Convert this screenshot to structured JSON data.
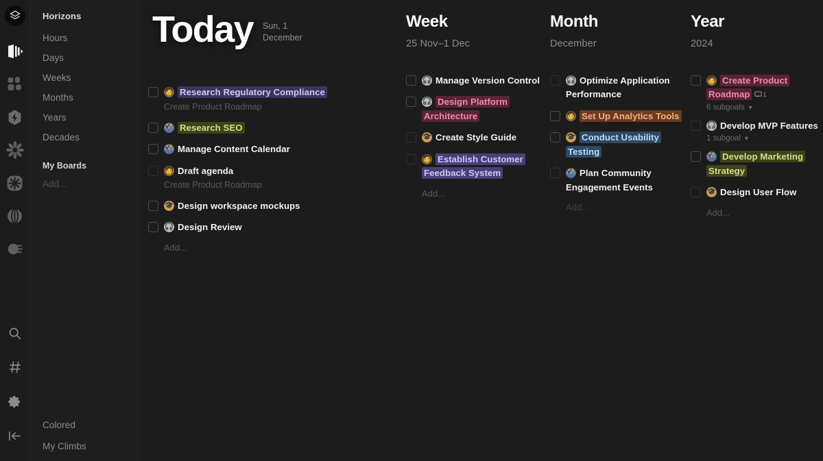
{
  "rail": {
    "icons": [
      {
        "name": "layers-logo-icon",
        "label": "Layers"
      },
      {
        "name": "book-open-icon",
        "label": "Journal"
      },
      {
        "name": "petals-grid-icon",
        "label": "Boards"
      },
      {
        "name": "hexagon-bolt-icon",
        "label": "Energy"
      },
      {
        "name": "flower-burst-icon",
        "label": "Flower"
      },
      {
        "name": "star-square-icon",
        "label": "Star"
      },
      {
        "name": "globe-lines-icon",
        "label": "Globe"
      },
      {
        "name": "comet-icon",
        "label": "Comet"
      }
    ],
    "bottom_icons": [
      {
        "name": "search-icon",
        "label": "Search"
      },
      {
        "name": "hash-icon",
        "label": "Tags"
      },
      {
        "name": "gear-icon",
        "label": "Settings"
      },
      {
        "name": "collapse-sidebar-icon",
        "label": "Collapse"
      }
    ]
  },
  "sidebar": {
    "heading": "Horizons",
    "items": [
      {
        "label": "Hours"
      },
      {
        "label": "Days"
      },
      {
        "label": "Weeks"
      },
      {
        "label": "Months"
      },
      {
        "label": "Years"
      },
      {
        "label": "Decades"
      }
    ],
    "boards_heading": "My Boards",
    "boards_add": "Add...",
    "footer": [
      {
        "label": "Colored"
      },
      {
        "label": "My Climbs"
      }
    ]
  },
  "columns": {
    "today": {
      "title": "Today",
      "subtitle": "Sun, 1 December",
      "add_label": "Add...",
      "add_dim": false,
      "tasks": [
        {
          "title": "Research Regulatory Compliance",
          "sub": "Create Product Roadmap",
          "avatar": "person-avatar",
          "avatar_color": "#8a6a4e",
          "highlight_bg": "#3a3560",
          "highlight_fg": "#cfc9ee",
          "checkbox_dim": false
        },
        {
          "title": "Research SEO",
          "sub": "",
          "avatar": "people-avatar",
          "avatar_color": "#5a6fa8",
          "highlight_bg": "#3f4318",
          "highlight_fg": "#d4dd8e",
          "checkbox_dim": false
        },
        {
          "title": "Manage Content Calendar",
          "sub": "",
          "avatar": "people-avatar",
          "avatar_color": "#5a6fa8",
          "highlight_bg": "",
          "highlight_fg": "#f0f0f0",
          "checkbox_dim": false
        },
        {
          "title": "Draft agenda",
          "sub": "Create Product Roadmap",
          "avatar": "person-avatar",
          "avatar_color": "#8a6a4e",
          "highlight_bg": "",
          "highlight_fg": "#f0f0f0",
          "checkbox_dim": true
        },
        {
          "title": "Design workspace mockups",
          "sub": "",
          "avatar": "graduate-avatar",
          "avatar_color": "#c79a63",
          "highlight_bg": "",
          "highlight_fg": "#f0f0f0",
          "checkbox_dim": false
        },
        {
          "title": "Design Review",
          "sub": "",
          "avatar": "headphones-avatar",
          "avatar_color": "#b9bec7",
          "highlight_bg": "",
          "highlight_fg": "#f0f0f0",
          "checkbox_dim": false
        }
      ]
    },
    "week": {
      "title": "Week",
      "subtitle": "25 Nov–1 Dec",
      "add_label": "Add...",
      "add_dim": false,
      "tasks": [
        {
          "title": "Manage Version Control",
          "sub": "",
          "avatar": "headphones-avatar",
          "avatar_color": "#b9bec7",
          "highlight_bg": "",
          "highlight_fg": "#f0f0f0",
          "checkbox_dim": false
        },
        {
          "title": "Design Platform Architecture",
          "sub": "",
          "avatar": "headphones-avatar",
          "avatar_color": "#b9bec7",
          "highlight_bg": "#5b2336",
          "highlight_fg": "#eb8ba8",
          "checkbox_dim": false
        },
        {
          "title": "Create Style Guide",
          "sub": "",
          "avatar": "graduate-avatar",
          "avatar_color": "#c79a63",
          "highlight_bg": "",
          "highlight_fg": "#f0f0f0",
          "checkbox_dim": true
        },
        {
          "title": "Establish Customer Feedback System",
          "sub": "",
          "avatar": "person-avatar",
          "avatar_color": "#8a6a4e",
          "highlight_bg": "#474078",
          "highlight_fg": "#cfc6f5",
          "checkbox_dim": true
        }
      ]
    },
    "month": {
      "title": "Month",
      "subtitle": "December",
      "add_label": "Add...",
      "add_dim": true,
      "tasks": [
        {
          "title": "Optimize Application Performance",
          "sub": "",
          "avatar": "headphones-avatar",
          "avatar_color": "#b9bec7",
          "highlight_bg": "",
          "highlight_fg": "#f0f0f0",
          "checkbox_dim": true
        },
        {
          "title": "Set Up Analytics Tools",
          "sub": "",
          "avatar": "person-avatar",
          "avatar_color": "#8a6a4e",
          "highlight_bg": "#6b3b1f",
          "highlight_fg": "#f0b183",
          "checkbox_dim": false
        },
        {
          "title": "Conduct Usability Testing",
          "sub": "",
          "avatar": "graduate-avatar",
          "avatar_color": "#c79a63",
          "highlight_bg": "#2b4a66",
          "highlight_fg": "#bcd9f2",
          "checkbox_dim": false
        },
        {
          "title": "Plan Community Engagement Events",
          "sub": "",
          "avatar": "people-avatar",
          "avatar_color": "#5a6fa8",
          "highlight_bg": "",
          "highlight_fg": "#f0f0f0",
          "checkbox_dim": true
        }
      ]
    },
    "year": {
      "title": "Year",
      "subtitle": "2024",
      "add_label": "Add...",
      "add_dim": false,
      "tasks": [
        {
          "title": "Create Product Roadmap",
          "sub": "",
          "avatar": "person-avatar",
          "avatar_color": "#8a6a4e",
          "highlight_bg": "#5b2336",
          "highlight_fg": "#eb8ba8",
          "checkbox_dim": false,
          "comment_count": "1",
          "meta": "6 subgoals"
        },
        {
          "title": "Develop MVP Features",
          "sub": "",
          "avatar": "headphones-avatar",
          "avatar_color": "#b9bec7",
          "highlight_bg": "",
          "highlight_fg": "#f0f0f0",
          "checkbox_dim": true,
          "meta": "1 subgoal"
        },
        {
          "title": "Develop Marketing Strategy",
          "sub": "",
          "avatar": "people-avatar",
          "avatar_color": "#5a6fa8",
          "highlight_bg": "#3f4318",
          "highlight_fg": "#d4dd8e",
          "checkbox_dim": false
        },
        {
          "title": "Design User Flow",
          "sub": "",
          "avatar": "graduate-avatar",
          "avatar_color": "#c79a63",
          "highlight_bg": "",
          "highlight_fg": "#f0f0f0",
          "checkbox_dim": true
        }
      ]
    }
  }
}
